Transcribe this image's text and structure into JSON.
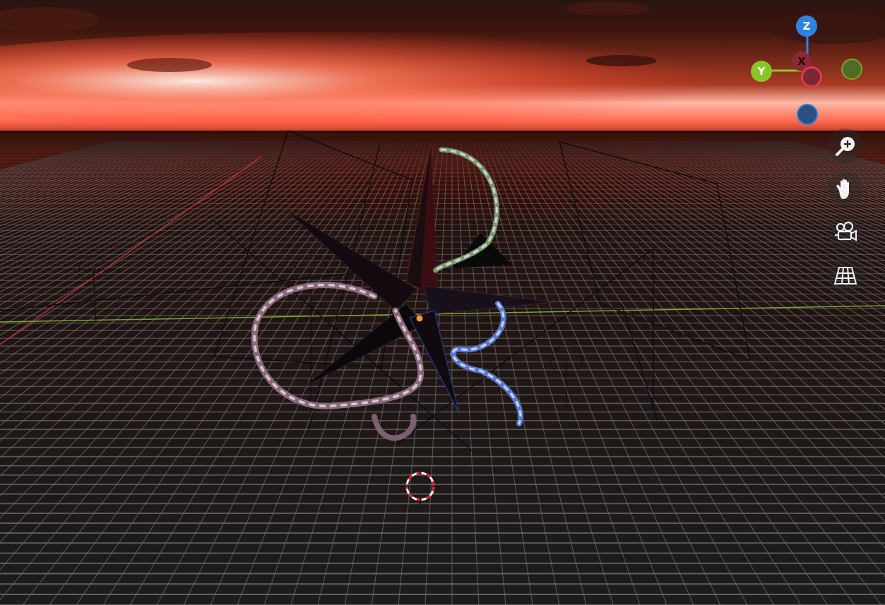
{
  "viewport": {
    "colors": {
      "sky_top": "#2a0d08",
      "sky_glow": "#ff5a3c",
      "horizon": "#5a0e06",
      "floor": "#202020",
      "grid_line": "#6a6a6a",
      "x_axis_line": "#b8303e",
      "y_axis_line": "#7aa22a",
      "object_origin": "#ff9a1f"
    }
  },
  "gizmo": {
    "z_label": "Z",
    "x_label": "X",
    "y_label": "Y",
    "colors": {
      "x": "#e2394f",
      "y": "#8ac528",
      "z": "#2f83e0"
    }
  },
  "toolbar": {
    "zoom_icon": "zoom-in-icon",
    "pan_icon": "hand-pan-icon",
    "camera_icon": "camera-view-icon",
    "ortho_icon": "ortho-grid-icon"
  }
}
